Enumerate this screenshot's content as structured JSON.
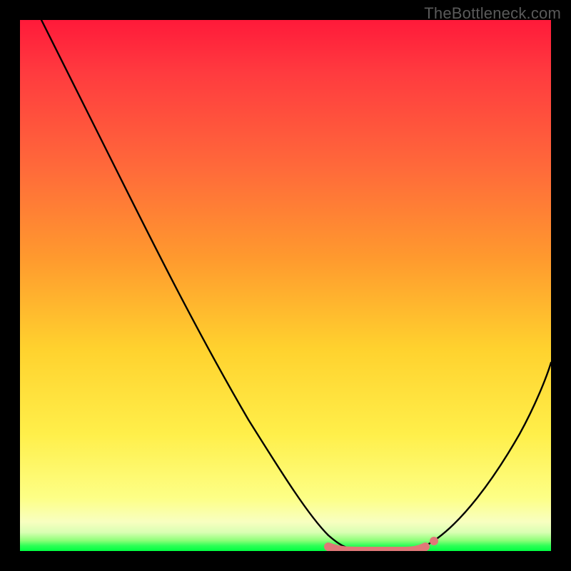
{
  "watermark": {
    "text": "TheBottleneck.com"
  },
  "chart_data": {
    "type": "line",
    "title": "",
    "xlabel": "",
    "ylabel": "",
    "xlim": [
      0,
      100
    ],
    "ylim": [
      0,
      100
    ],
    "grid": false,
    "legend": false,
    "gradient_colors": {
      "top": "#ff1a3a",
      "mid": "#ffd22e",
      "bottom_accent": "#00ff41"
    },
    "series": [
      {
        "name": "bottleneck-curve",
        "color": "#000000",
        "x": [
          4,
          8,
          12,
          16,
          20,
          24,
          28,
          32,
          36,
          40,
          44,
          48,
          52,
          55,
          58,
          60,
          62,
          65,
          68,
          71,
          74,
          77,
          80,
          83,
          86,
          89,
          92,
          95,
          98,
          100
        ],
        "values": [
          100,
          93,
          86,
          79,
          72,
          65,
          58,
          51,
          44,
          37,
          30,
          24,
          18,
          13,
          8,
          5,
          3,
          1,
          0,
          0,
          0,
          1,
          3,
          6,
          11,
          17,
          24,
          32,
          40,
          45
        ]
      }
    ],
    "marker_run": {
      "name": "highlight-segment",
      "color": "#e07878",
      "x_start": 58,
      "x_end": 77,
      "y": 0.5,
      "end_dot": {
        "x": 77,
        "y": 1.5
      }
    }
  }
}
